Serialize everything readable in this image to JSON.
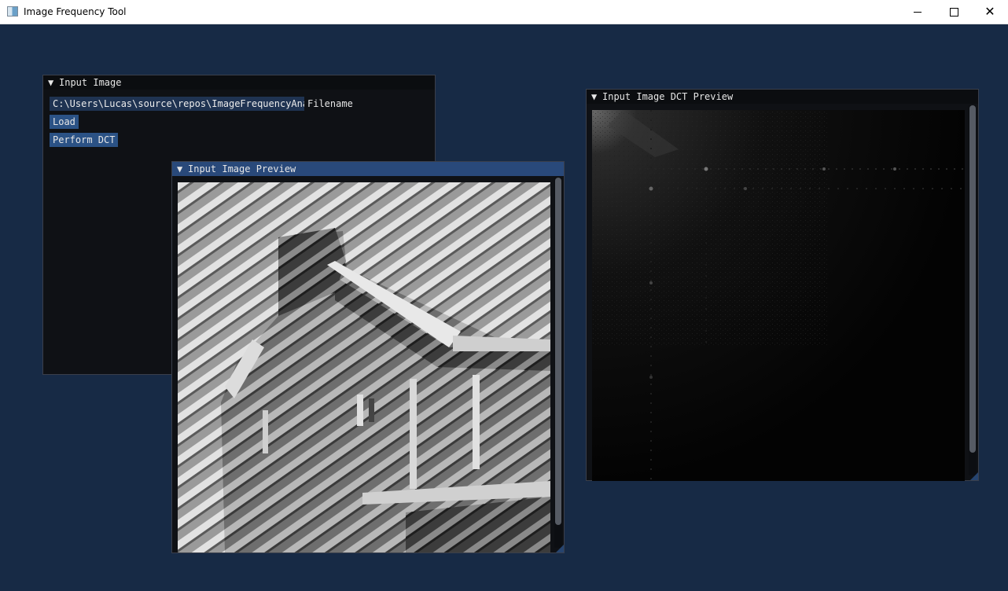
{
  "window": {
    "title": "Image Frequency Tool"
  },
  "input_image_window": {
    "title": "Input Image",
    "filename_value": "C:\\Users\\Lucas\\source\\repos\\ImageFrequencyAnal",
    "filename_label": "Filename",
    "load_label": "Load",
    "dct_label": "Perform DCT"
  },
  "preview_window": {
    "title": "Input Image Preview"
  },
  "dct_window": {
    "title": "Input Image DCT Preview"
  },
  "colors": {
    "background": "#172a45",
    "active_title": "#29497a",
    "button": "#2b5285",
    "input": "#1f3352"
  }
}
